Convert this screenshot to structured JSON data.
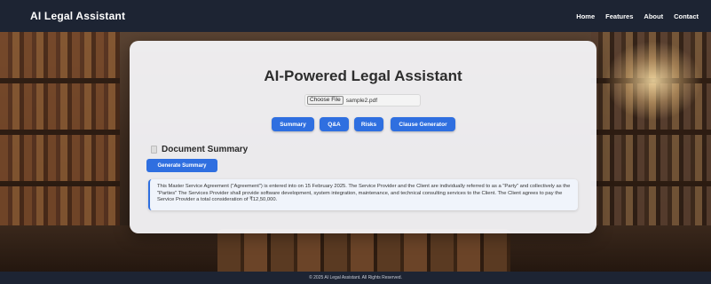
{
  "navbar": {
    "brand": "AI Legal Assistant",
    "links": [
      "Home",
      "Features",
      "About",
      "Contact"
    ]
  },
  "main": {
    "title": "AI-Powered Legal Assistant",
    "file_button": "Choose File",
    "file_name": "sample2.pdf",
    "tabs": [
      "Summary",
      "Q&A",
      "Risks",
      "Clause Generator"
    ],
    "section_title": "Document Summary",
    "generate_button": "Generate Summary",
    "summary_text": "This Master Service Agreement (\"Agreement\") is entered into on 15 February 2025. The Service Provider and the Client are individually referred to as a \"Party\" and collectively as the \"Parties\" The Services Provider shall provide software development, system integration, maintenance, and technical consulting services to the Client. The Client agrees to pay the Service Provider a total consideration of ₹12,50,000."
  },
  "footer": {
    "text": "© 2025 AI Legal Assistant. All Rights Reserved."
  },
  "colors": {
    "navbar": "#1d2433",
    "accent": "#2f6fe0",
    "card": "#f6f7fa"
  }
}
